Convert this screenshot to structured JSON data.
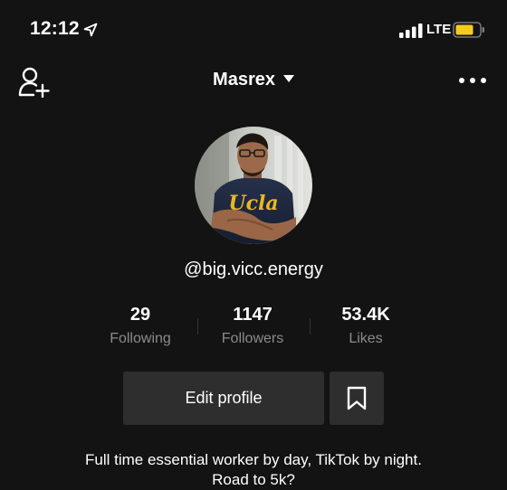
{
  "status_bar": {
    "time": "12:12",
    "network": "LTE",
    "icons": {
      "location": "location-arrow-icon",
      "signal": "signal-bars-icon",
      "battery": "battery-icon"
    },
    "colors": {
      "battery_fill": "#f5cc1b"
    }
  },
  "header": {
    "username": "Masrex",
    "icons": {
      "add_friend": "add-person-icon",
      "username_dropdown": "caret-down-icon",
      "more": "more-dots-icon"
    }
  },
  "profile": {
    "handle": "@big.vicc.energy",
    "stats": [
      {
        "value": "29",
        "label": "Following"
      },
      {
        "value": "1147",
        "label": "Followers"
      },
      {
        "value": "53.4K",
        "label": "Likes"
      }
    ],
    "edit_profile_label": "Edit profile",
    "bookmark_icon": "bookmark-icon",
    "bio_line1": "Full time essential worker by day, TikTok by night.",
    "bio_line2": "Road to 5k?"
  },
  "theme": {
    "background": "#131313",
    "button_bg": "#2e2e2e",
    "secondary_text": "#8b8b8b"
  }
}
